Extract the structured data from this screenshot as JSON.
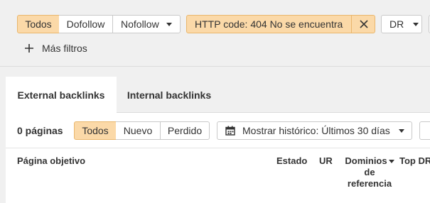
{
  "filters": {
    "segment": [
      {
        "label": "Todos",
        "active": true
      },
      {
        "label": "Dofollow",
        "active": false
      },
      {
        "label": "Nofollow",
        "active": false
      }
    ],
    "http_chip": {
      "label": "HTTP code: 404 No se encuentra"
    },
    "dr_label": "DR",
    "more_filters": "Más filtros"
  },
  "tabs": [
    {
      "label": "External backlinks",
      "active": true
    },
    {
      "label": "Internal backlinks",
      "active": false
    }
  ],
  "toolbar": {
    "count_label": "0 páginas",
    "segment": [
      {
        "label": "Todos",
        "active": true
      },
      {
        "label": "Nuevo",
        "active": false
      },
      {
        "label": "Perdido",
        "active": false
      }
    ],
    "history_label": "Mostrar histórico: Últimos 30 días"
  },
  "table": {
    "columns": {
      "target_page": "Página objetivo",
      "status": "Estado",
      "ur": "UR",
      "domains_line1": "Dominios",
      "domains_line2": "de",
      "domains_line3": "referencia",
      "top_dr": "Top DR"
    }
  },
  "colors": {
    "accent_fill": "#fbd9a8",
    "accent_border": "#e9b66c",
    "background": "#f0f0f0"
  }
}
